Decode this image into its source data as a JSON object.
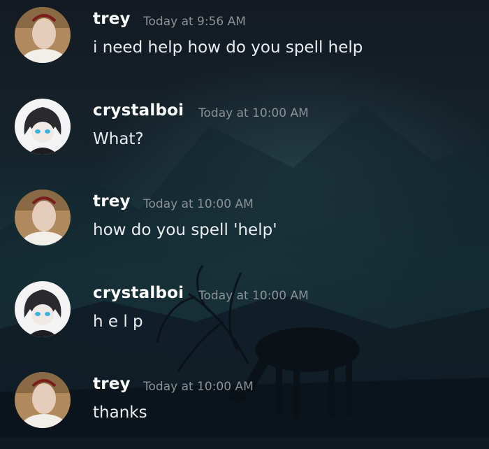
{
  "messages": [
    {
      "author": "trey",
      "timestamp": "Today at 9:56 AM",
      "content": "i need help how do you spell help",
      "avatar_icon": "trey-avatar-icon"
    },
    {
      "author": "crystalboi",
      "timestamp": "Today at 10:00 AM",
      "content": "What?",
      "avatar_icon": "crystalboi-avatar-icon"
    },
    {
      "author": "trey",
      "timestamp": "Today at 10:00 AM",
      "content": "how do you spell 'help'",
      "avatar_icon": "trey-avatar-icon"
    },
    {
      "author": "crystalboi",
      "timestamp": "Today at 10:00 AM",
      "content": "h e l p",
      "avatar_icon": "crystalboi-avatar-icon"
    },
    {
      "author": "trey",
      "timestamp": "Today at 10:00 AM",
      "content": "thanks",
      "avatar_icon": "trey-avatar-icon"
    }
  ],
  "colors": {
    "username": "#ffffff",
    "timestamp": "#8a9296",
    "content": "#e8ecee"
  }
}
